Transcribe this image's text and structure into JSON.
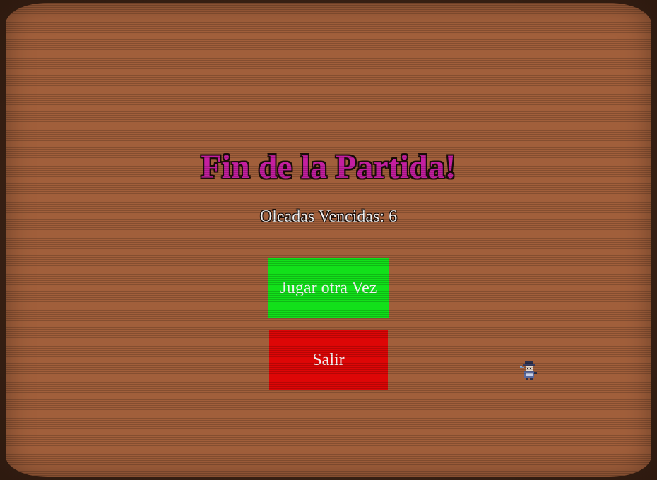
{
  "game_over": {
    "title": "Fin de la Partida!",
    "waves_label": "Oleadas Vencidas: 6",
    "waves_count": 6
  },
  "buttons": {
    "play_again_label": "Jugar otra Vez",
    "exit_label": "Salir"
  },
  "colors": {
    "background": "#a15f3b",
    "title": "#c41fa0",
    "play_again": "#12e01a",
    "exit": "#dd0606"
  },
  "sprite": {
    "icon": "character-sprite-icon"
  }
}
